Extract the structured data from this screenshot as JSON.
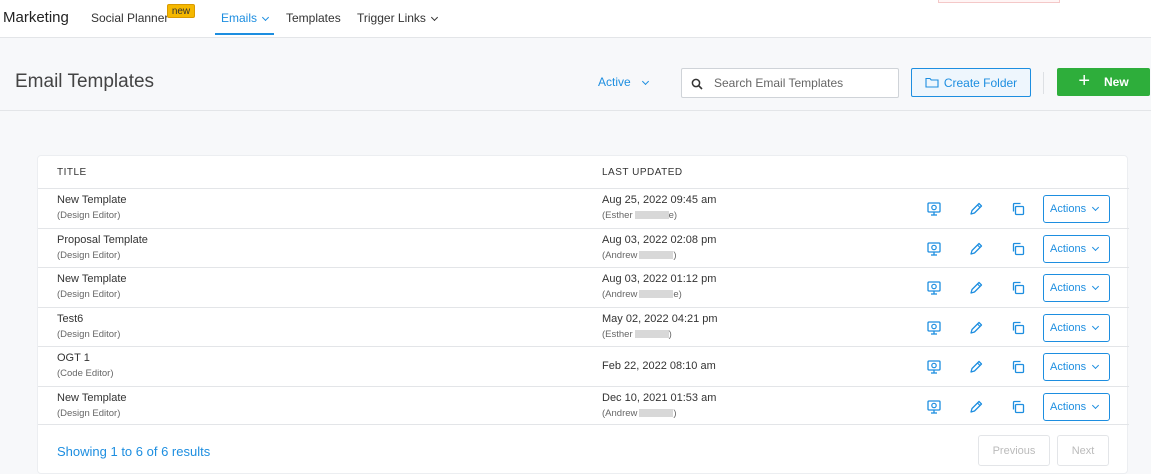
{
  "nav": {
    "brand": "Marketing",
    "items": [
      {
        "label": "Social Planner",
        "badge": "new"
      },
      {
        "label": "Emails",
        "active": true
      },
      {
        "label": "Templates"
      },
      {
        "label": "Trigger Links"
      }
    ]
  },
  "header": {
    "title": "Email Templates",
    "filter": "Active",
    "search_placeholder": "Search Email Templates",
    "create_folder": "Create Folder",
    "new": "New"
  },
  "table": {
    "columns": {
      "title": "TITLE",
      "last_updated": "LAST UPDATED"
    },
    "actions_label": "Actions",
    "rows": [
      {
        "title": "New Template",
        "editor": "(Design Editor)",
        "date": "Aug 25, 2022 09:45 am",
        "author": "(Esther",
        "author_end": "e)"
      },
      {
        "title": "Proposal Template",
        "editor": "(Design Editor)",
        "date": "Aug 03, 2022 02:08 pm",
        "author": "(Andrew",
        "author_end": ")"
      },
      {
        "title": "New Template",
        "editor": "(Design Editor)",
        "date": "Aug 03, 2022 01:12 pm",
        "author": "(Andrew",
        "author_end": "e)"
      },
      {
        "title": "Test6",
        "editor": "(Design Editor)",
        "date": "May 02, 2022 04:21 pm",
        "author": "(Esther",
        "author_end": ")"
      },
      {
        "title": "OGT 1",
        "editor": "(Code Editor)",
        "date": "Feb 22, 2022 08:10 am",
        "author": "",
        "author_end": ""
      },
      {
        "title": "New Template",
        "editor": "(Design Editor)",
        "date": "Dec 10, 2021 01:53 am",
        "author": "(Andrew",
        "author_end": ")"
      }
    ]
  },
  "footer": {
    "showing": "Showing 1 to 6 of 6 results",
    "previous": "Previous",
    "next": "Next"
  },
  "colors": {
    "accent": "#1d8ee0",
    "primary_button": "#2eae3b",
    "badge": "#f5b800"
  }
}
